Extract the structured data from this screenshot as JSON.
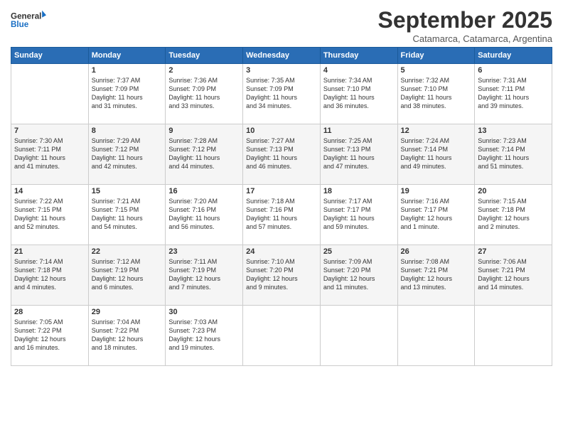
{
  "logo": {
    "line1": "General",
    "line2": "Blue"
  },
  "title": "September 2025",
  "subtitle": "Catamarca, Catamarca, Argentina",
  "days_of_week": [
    "Sunday",
    "Monday",
    "Tuesday",
    "Wednesday",
    "Thursday",
    "Friday",
    "Saturday"
  ],
  "weeks": [
    [
      {
        "num": "",
        "info": ""
      },
      {
        "num": "1",
        "info": "Sunrise: 7:37 AM\nSunset: 7:09 PM\nDaylight: 11 hours\nand 31 minutes."
      },
      {
        "num": "2",
        "info": "Sunrise: 7:36 AM\nSunset: 7:09 PM\nDaylight: 11 hours\nand 33 minutes."
      },
      {
        "num": "3",
        "info": "Sunrise: 7:35 AM\nSunset: 7:09 PM\nDaylight: 11 hours\nand 34 minutes."
      },
      {
        "num": "4",
        "info": "Sunrise: 7:34 AM\nSunset: 7:10 PM\nDaylight: 11 hours\nand 36 minutes."
      },
      {
        "num": "5",
        "info": "Sunrise: 7:32 AM\nSunset: 7:10 PM\nDaylight: 11 hours\nand 38 minutes."
      },
      {
        "num": "6",
        "info": "Sunrise: 7:31 AM\nSunset: 7:11 PM\nDaylight: 11 hours\nand 39 minutes."
      }
    ],
    [
      {
        "num": "7",
        "info": "Sunrise: 7:30 AM\nSunset: 7:11 PM\nDaylight: 11 hours\nand 41 minutes."
      },
      {
        "num": "8",
        "info": "Sunrise: 7:29 AM\nSunset: 7:12 PM\nDaylight: 11 hours\nand 42 minutes."
      },
      {
        "num": "9",
        "info": "Sunrise: 7:28 AM\nSunset: 7:12 PM\nDaylight: 11 hours\nand 44 minutes."
      },
      {
        "num": "10",
        "info": "Sunrise: 7:27 AM\nSunset: 7:13 PM\nDaylight: 11 hours\nand 46 minutes."
      },
      {
        "num": "11",
        "info": "Sunrise: 7:25 AM\nSunset: 7:13 PM\nDaylight: 11 hours\nand 47 minutes."
      },
      {
        "num": "12",
        "info": "Sunrise: 7:24 AM\nSunset: 7:14 PM\nDaylight: 11 hours\nand 49 minutes."
      },
      {
        "num": "13",
        "info": "Sunrise: 7:23 AM\nSunset: 7:14 PM\nDaylight: 11 hours\nand 51 minutes."
      }
    ],
    [
      {
        "num": "14",
        "info": "Sunrise: 7:22 AM\nSunset: 7:15 PM\nDaylight: 11 hours\nand 52 minutes."
      },
      {
        "num": "15",
        "info": "Sunrise: 7:21 AM\nSunset: 7:15 PM\nDaylight: 11 hours\nand 54 minutes."
      },
      {
        "num": "16",
        "info": "Sunrise: 7:20 AM\nSunset: 7:16 PM\nDaylight: 11 hours\nand 56 minutes."
      },
      {
        "num": "17",
        "info": "Sunrise: 7:18 AM\nSunset: 7:16 PM\nDaylight: 11 hours\nand 57 minutes."
      },
      {
        "num": "18",
        "info": "Sunrise: 7:17 AM\nSunset: 7:17 PM\nDaylight: 11 hours\nand 59 minutes."
      },
      {
        "num": "19",
        "info": "Sunrise: 7:16 AM\nSunset: 7:17 PM\nDaylight: 12 hours\nand 1 minute."
      },
      {
        "num": "20",
        "info": "Sunrise: 7:15 AM\nSunset: 7:18 PM\nDaylight: 12 hours\nand 2 minutes."
      }
    ],
    [
      {
        "num": "21",
        "info": "Sunrise: 7:14 AM\nSunset: 7:18 PM\nDaylight: 12 hours\nand 4 minutes."
      },
      {
        "num": "22",
        "info": "Sunrise: 7:12 AM\nSunset: 7:19 PM\nDaylight: 12 hours\nand 6 minutes."
      },
      {
        "num": "23",
        "info": "Sunrise: 7:11 AM\nSunset: 7:19 PM\nDaylight: 12 hours\nand 7 minutes."
      },
      {
        "num": "24",
        "info": "Sunrise: 7:10 AM\nSunset: 7:20 PM\nDaylight: 12 hours\nand 9 minutes."
      },
      {
        "num": "25",
        "info": "Sunrise: 7:09 AM\nSunset: 7:20 PM\nDaylight: 12 hours\nand 11 minutes."
      },
      {
        "num": "26",
        "info": "Sunrise: 7:08 AM\nSunset: 7:21 PM\nDaylight: 12 hours\nand 13 minutes."
      },
      {
        "num": "27",
        "info": "Sunrise: 7:06 AM\nSunset: 7:21 PM\nDaylight: 12 hours\nand 14 minutes."
      }
    ],
    [
      {
        "num": "28",
        "info": "Sunrise: 7:05 AM\nSunset: 7:22 PM\nDaylight: 12 hours\nand 16 minutes."
      },
      {
        "num": "29",
        "info": "Sunrise: 7:04 AM\nSunset: 7:22 PM\nDaylight: 12 hours\nand 18 minutes."
      },
      {
        "num": "30",
        "info": "Sunrise: 7:03 AM\nSunset: 7:23 PM\nDaylight: 12 hours\nand 19 minutes."
      },
      {
        "num": "",
        "info": ""
      },
      {
        "num": "",
        "info": ""
      },
      {
        "num": "",
        "info": ""
      },
      {
        "num": "",
        "info": ""
      }
    ]
  ]
}
